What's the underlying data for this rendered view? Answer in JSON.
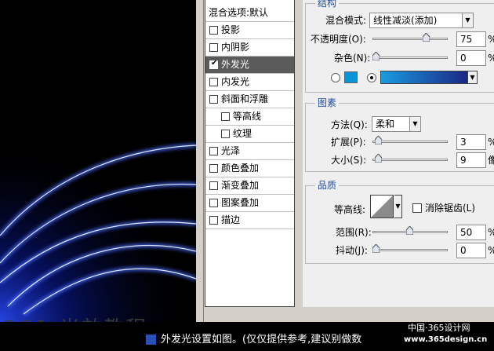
{
  "watermark": {
    "text": "OOL 光效教程"
  },
  "style_list": {
    "header": "混合选项:默认",
    "items": [
      {
        "label": "投影",
        "checked": false,
        "indent": false,
        "selected": false
      },
      {
        "label": "内阴影",
        "checked": false,
        "indent": false,
        "selected": false
      },
      {
        "label": "外发光",
        "checked": true,
        "indent": false,
        "selected": true
      },
      {
        "label": "内发光",
        "checked": false,
        "indent": false,
        "selected": false
      },
      {
        "label": "斜面和浮雕",
        "checked": false,
        "indent": false,
        "selected": false
      },
      {
        "label": "等高线",
        "checked": false,
        "indent": true,
        "selected": false
      },
      {
        "label": "纹理",
        "checked": false,
        "indent": true,
        "selected": false
      },
      {
        "label": "光泽",
        "checked": false,
        "indent": false,
        "selected": false
      },
      {
        "label": "颜色叠加",
        "checked": false,
        "indent": false,
        "selected": false
      },
      {
        "label": "渐变叠加",
        "checked": false,
        "indent": false,
        "selected": false
      },
      {
        "label": "图案叠加",
        "checked": false,
        "indent": false,
        "selected": false
      },
      {
        "label": "描边",
        "checked": false,
        "indent": false,
        "selected": false
      }
    ]
  },
  "structure": {
    "title": "结构",
    "blend_mode_label": "混合模式:",
    "blend_mode_value": "线性减淡(添加)",
    "opacity_label": "不透明度(O):",
    "opacity_value": "75",
    "opacity_pct": 75,
    "noise_label": "杂色(N):",
    "noise_value": "0",
    "noise_pct": 0,
    "unit_percent": "%",
    "swatch_color": "#0a95d9",
    "gradient_from": "#1a9be0",
    "gradient_to": "#1a1a7a"
  },
  "elements": {
    "title": "图素",
    "method_label": "方法(Q):",
    "method_value": "柔和",
    "spread_label": "扩展(P):",
    "spread_value": "3",
    "spread_pct": 3,
    "size_label": "大小(S):",
    "size_value": "9",
    "size_fraction": 0.036,
    "unit_percent": "%",
    "unit_px": "像"
  },
  "quality": {
    "title": "品质",
    "contour_label": "等高线:",
    "anti_alias_label": "消除锯齿(L)",
    "range_label": "范围(R):",
    "range_value": "50",
    "range_pct": 50,
    "jitter_label": "抖动(J):",
    "jitter_value": "0",
    "jitter_pct": 0,
    "unit_percent": "%"
  },
  "caption": {
    "text": "外发光设置如图。(仅仅提供参考,建议别做数"
  },
  "site": {
    "logo": "中国·365设计网",
    "url": "www.365design.cn"
  }
}
